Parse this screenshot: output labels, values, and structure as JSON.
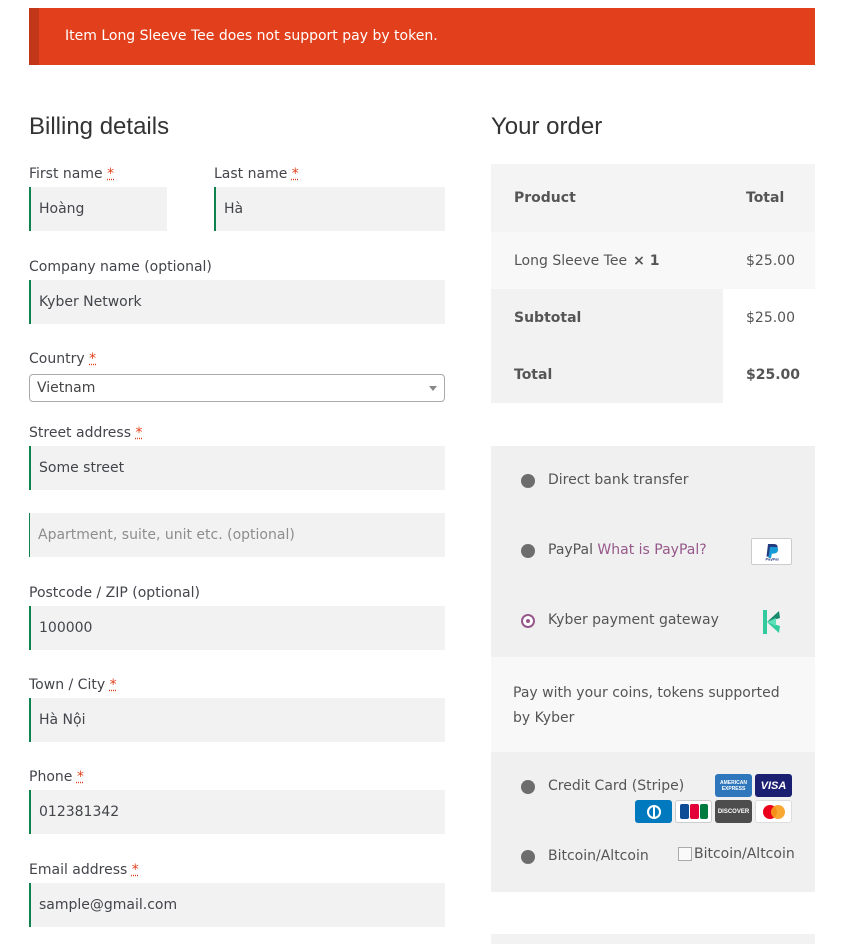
{
  "notice": {
    "message": "Item Long Sleeve Tee does not support pay by token."
  },
  "billing": {
    "title": "Billing details",
    "first_name": {
      "label": "First name",
      "value": "Hoàng"
    },
    "last_name": {
      "label": "Last name",
      "value": "Hà"
    },
    "company": {
      "label": "Company name (optional)",
      "value": "Kyber Network"
    },
    "country": {
      "label": "Country",
      "value": "Vietnam"
    },
    "street": {
      "label": "Street address",
      "value": "Some street",
      "placeholder2": "Apartment, suite, unit etc. (optional)"
    },
    "postcode": {
      "label": "Postcode / ZIP (optional)",
      "value": "100000"
    },
    "city": {
      "label": "Town / City",
      "value": "Hà Nội"
    },
    "phone": {
      "label": "Phone",
      "value": "012381342"
    },
    "email": {
      "label": "Email address",
      "value": "sample@gmail.com"
    },
    "required_mark": "*"
  },
  "order": {
    "title": "Your order",
    "col_product": "Product",
    "col_total": "Total",
    "item_name": "Long Sleeve Tee",
    "item_qty": "× 1",
    "item_total": "$25.00",
    "subtotal_label": "Subtotal",
    "subtotal_value": "$25.00",
    "total_label": "Total",
    "total_value": "$25.00"
  },
  "payment": {
    "bank": "Direct bank transfer",
    "paypal": "PayPal",
    "paypal_link": "What is PayPal?",
    "kyber": "Kyber payment gateway",
    "kyber_desc": "Pay with your coins, tokens supported by Kyber",
    "stripe": "Credit Card (Stripe)",
    "bitcoin": "Bitcoin/Altcoin",
    "bitcoin_alt": "Bitcoin/Altcoin",
    "selected": "kyber"
  },
  "cards": {
    "amex": "AMERICAN EXPRESS",
    "visa": "VISA",
    "discover": "DISCOVER"
  },
  "colors": {
    "notice_bg": "#e2401c",
    "accent": "#96588a",
    "field_border": "#0f834d",
    "kyber_green": "#31cb9e"
  }
}
